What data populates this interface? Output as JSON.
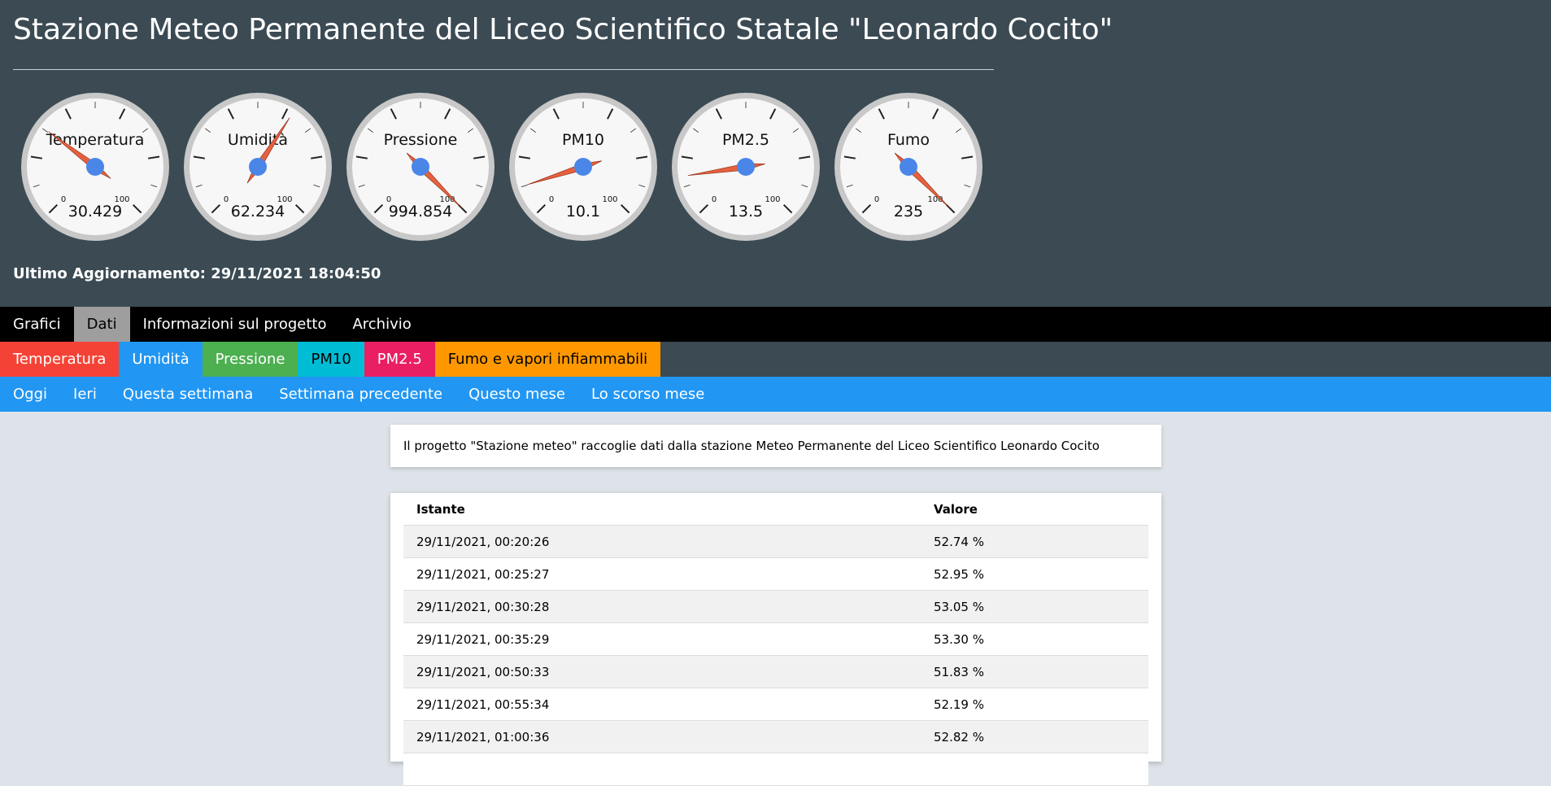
{
  "header": {
    "title": "Stazione Meteo Permanente del Liceo Scientifico Statale \"Leonardo Cocito\"",
    "last_update": "Ultimo Aggiornamento: 29/11/2021 18:04:50"
  },
  "gauges": [
    {
      "label": "Temperatura",
      "value": "30.429",
      "needle_fraction": 0.304
    },
    {
      "label": "Umidità",
      "value": "62.234",
      "needle_fraction": 0.622
    },
    {
      "label": "Pressione",
      "value": "994.854",
      "needle_fraction": 1.0
    },
    {
      "label": "PM10",
      "value": "10.1",
      "needle_fraction": 0.101
    },
    {
      "label": "PM2.5",
      "value": "13.5",
      "needle_fraction": 0.135
    },
    {
      "label": "Fumo",
      "value": "235",
      "needle_fraction": 1.0
    }
  ],
  "gauge_scale": {
    "min": "0",
    "max": "100"
  },
  "nav_main": [
    {
      "label": "Grafici",
      "active": false
    },
    {
      "label": "Dati",
      "active": true
    },
    {
      "label": "Informazioni sul progetto",
      "active": false
    },
    {
      "label": "Archivio",
      "active": false
    }
  ],
  "nav_sensors": [
    {
      "label": "Temperatura",
      "bg": "#f44336",
      "fg": "#ffffff"
    },
    {
      "label": "Umidità",
      "bg": "#2196f3",
      "fg": "#ffffff"
    },
    {
      "label": "Pressione",
      "bg": "#4caf50",
      "fg": "#ffffff"
    },
    {
      "label": "PM10",
      "bg": "#00bcd4",
      "fg": "#000000"
    },
    {
      "label": "PM2.5",
      "bg": "#e91e63",
      "fg": "#ffffff"
    },
    {
      "label": "Fumo e vapori infiammabili",
      "bg": "#ff9800",
      "fg": "#000000"
    }
  ],
  "nav_period": [
    {
      "label": "Oggi"
    },
    {
      "label": "Ieri"
    },
    {
      "label": "Questa settimana"
    },
    {
      "label": "Settimana precedente"
    },
    {
      "label": "Questo mese"
    },
    {
      "label": "Lo scorso mese"
    }
  ],
  "info_text": "Il progetto \"Stazione meteo\" raccoglie dati dalla stazione Meteo Permanente del Liceo Scientifico Leonardo Cocito",
  "table": {
    "headers": [
      "Istante",
      "Valore"
    ],
    "rows": [
      [
        "29/11/2021, 00:20:26",
        "52.74 %"
      ],
      [
        "29/11/2021, 00:25:27",
        "52.95 %"
      ],
      [
        "29/11/2021, 00:30:28",
        "53.05 %"
      ],
      [
        "29/11/2021, 00:35:29",
        "53.30 %"
      ],
      [
        "29/11/2021, 00:50:33",
        "51.83 %"
      ],
      [
        "29/11/2021, 00:55:34",
        "52.19 %"
      ],
      [
        "29/11/2021, 01:00:36",
        "52.82 %"
      ],
      [
        "",
        ""
      ]
    ]
  },
  "colors": {
    "header_bg": "#3b4a53",
    "needle": "#e5603f",
    "hub": "#4a86e8",
    "gauge_face": "#f7f7f7",
    "gauge_rim": "#c8c8c8"
  }
}
